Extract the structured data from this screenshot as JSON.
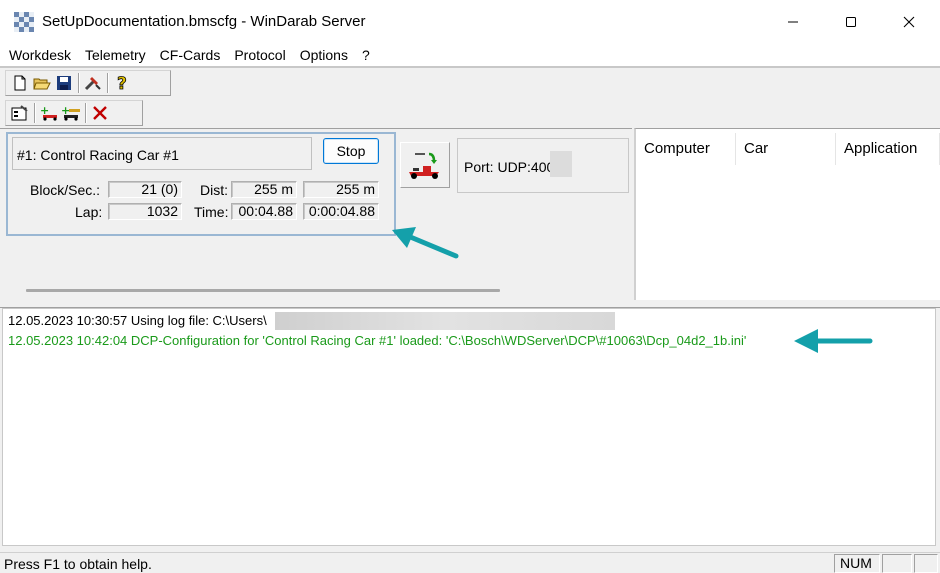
{
  "window": {
    "title": "SetUpDocumentation.bmscfg - WinDarab Server",
    "app_icon": "checkerboard-flag-icon",
    "controls": [
      "minimize-icon",
      "maximize-icon",
      "close-icon"
    ]
  },
  "menu": {
    "items": [
      "Workdesk",
      "Telemetry",
      "CF-Cards",
      "Protocol",
      "Options",
      "?"
    ]
  },
  "toolbar1": {
    "buttons": [
      "new-file-icon",
      "open-folder-icon",
      "save-icon",
      "tools-icon",
      "help-icon"
    ]
  },
  "toolbar2": {
    "buttons": [
      "properties-icon",
      "add-car-icon",
      "add-multiple-cars-icon",
      "delete-icon"
    ]
  },
  "car_panel": {
    "name": "#1: Control Racing Car #1",
    "stop_label": "Stop",
    "block_label": "Block/Sec.:",
    "block_value": "21 (0)",
    "dist_label": "Dist:",
    "dist_value1": "255 m",
    "dist_value2": "255 m",
    "lap_label": "Lap:",
    "lap_value": "1032",
    "time_label": "Time:",
    "time_value1": "00:04.88",
    "time_value2": "0:00:04.88"
  },
  "port": {
    "text": "Port: UDP:400"
  },
  "client_list": {
    "columns": [
      "Computer",
      "Car",
      "Application"
    ]
  },
  "log": {
    "lines": [
      {
        "text": "12.05.2023 10:30:57 Using log file: C:\\Users\\",
        "color": "#000000"
      },
      {
        "text": "12.05.2023 10:42:04 DCP-Configuration for 'Control Racing Car #1' loaded: 'C:\\Bosch\\WDServer\\DCP\\#10063\\Dcp_04d2_1b.ini'",
        "color": "#1a9a1a"
      }
    ]
  },
  "annotation": {
    "arrow_color": "#14a0aa"
  },
  "statusbar": {
    "help_text": "Press F1 to obtain help.",
    "num_indicator": "NUM"
  }
}
